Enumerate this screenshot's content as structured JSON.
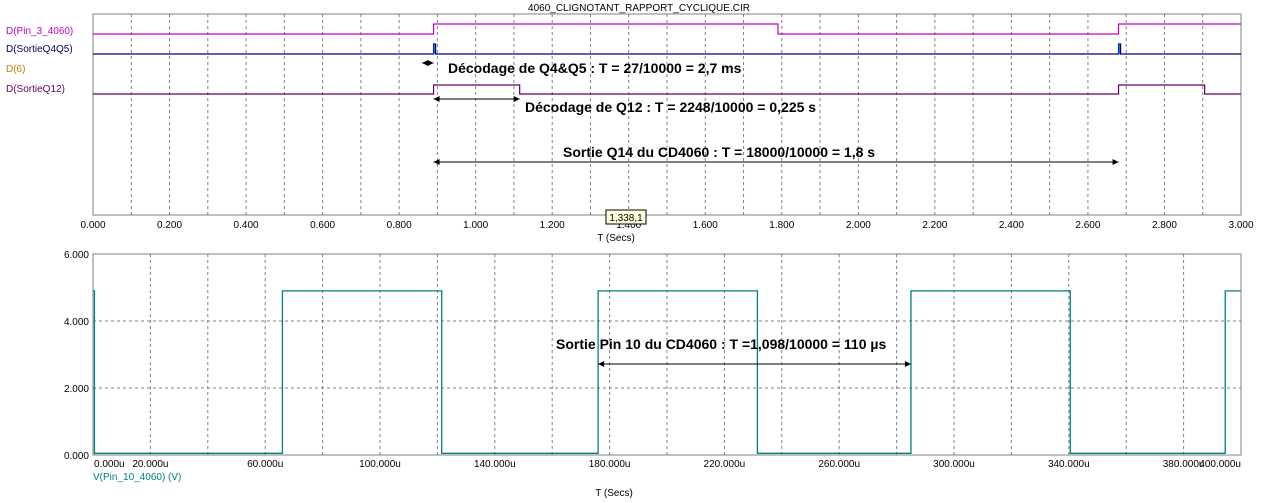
{
  "title": "4060_CLIGNOTANT_RAPPORT_CYCLIQUE.CIR",
  "cursor_readout": "1,338,1",
  "colors": {
    "pin3": "#c000c0",
    "sortie_q4q5": "#000060",
    "label_d6": "#c08000",
    "sortie_q12": "#600060",
    "analog": "#008080",
    "grid": "#808080"
  },
  "chart_data": [
    {
      "type": "line",
      "chart_id": "digital",
      "xlabel": "T (Secs)",
      "xlim": [
        0,
        3.0
      ],
      "x_ticks": [
        "0.000",
        "0.200",
        "0.400",
        "0.600",
        "0.800",
        "1.000",
        "1.200",
        "1.400",
        "1.600",
        "1.800",
        "2.000",
        "2.200",
        "2.400",
        "2.600",
        "2.800",
        "3.000"
      ],
      "series": [
        {
          "name": "D(Pin_3_4060)",
          "transitions": [
            0.0,
            0.89,
            1.79,
            2.68
          ],
          "levels": [
            0,
            1,
            0,
            1
          ]
        },
        {
          "name": "D(SortieQ4Q5)",
          "pulses": [
            [
              0.89,
              0.8927
            ],
            [
              2.68,
              2.6827
            ]
          ]
        },
        {
          "name": "D(6)"
        },
        {
          "name": "D(SortieQ12)",
          "transitions": [
            0.0,
            0.89,
            1.115,
            2.68,
            2.905
          ],
          "levels": [
            0,
            1,
            0,
            1,
            0
          ]
        }
      ],
      "annotations": [
        {
          "text": "Décodage de Q4&Q5  :  T = 27/10000 = 2,7 ms",
          "x_from": 0.86,
          "x_to": 0.89
        },
        {
          "text": "Décodage de Q12  :  T = 2248/10000 = 0,225 s",
          "x_from": 0.89,
          "x_to": 1.115
        },
        {
          "text": "Sortie Q14 du CD4060  : T = 18000/10000 = 1,8 s",
          "x_from": 0.89,
          "x_to": 2.68
        }
      ]
    },
    {
      "type": "line",
      "chart_id": "analog",
      "xlabel": "T (Secs)",
      "xlim": [
        0,
        400
      ],
      "ylim": [
        0,
        6
      ],
      "x_ticks": [
        "0.000u",
        "20.000u",
        "60.000u",
        "100.000u",
        "140.000u",
        "180.000u",
        "220.000u",
        "260.000u",
        "300.000u",
        "340.000u",
        "380.000u",
        "400.000u"
      ],
      "y_ticks": [
        "0.000",
        "2.000",
        "4.000",
        "6.000"
      ],
      "series": [
        {
          "name": "V(Pin_10_4060) (V)",
          "transitions": [
            0,
            0.5,
            66,
            120,
            121.5,
            176,
            230,
            231.5,
            285,
            339,
            340.5,
            394.5
          ],
          "levels": [
            4.9,
            0.05,
            4.9,
            4.9,
            0.05,
            4.9,
            4.9,
            0.05,
            4.9,
            4.9,
            0.05,
            4.9
          ]
        }
      ],
      "annotations": [
        {
          "text": "Sortie Pin 10 du CD4060 : T =1,098/10000 = 110 µs",
          "x_from": 176,
          "x_to": 285,
          "y": 2.7
        }
      ]
    }
  ]
}
